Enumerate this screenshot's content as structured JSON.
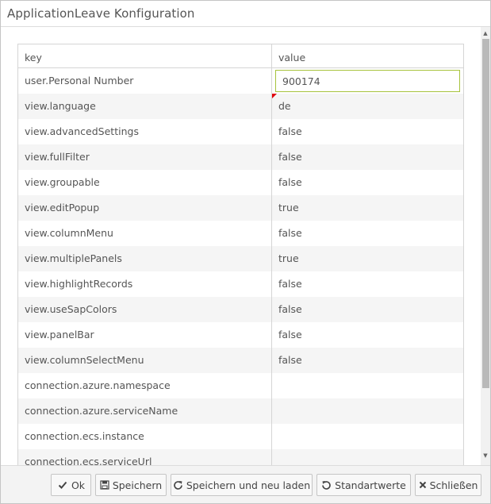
{
  "window": {
    "title": "ApplicationLeave Konfiguration"
  },
  "grid": {
    "columns": {
      "key": "key",
      "value": "value"
    },
    "rows": [
      {
        "key": "user.Personal Number",
        "value": "900174"
      },
      {
        "key": "view.language",
        "value": "de"
      },
      {
        "key": "view.advancedSettings",
        "value": "false"
      },
      {
        "key": "view.fullFilter",
        "value": "false"
      },
      {
        "key": "view.groupable",
        "value": "false"
      },
      {
        "key": "view.editPopup",
        "value": "true"
      },
      {
        "key": "view.columnMenu",
        "value": "false"
      },
      {
        "key": "view.multiplePanels",
        "value": "true"
      },
      {
        "key": "view.highlightRecords",
        "value": "false"
      },
      {
        "key": "view.useSapColors",
        "value": "false"
      },
      {
        "key": "view.panelBar",
        "value": "false"
      },
      {
        "key": "view.columnSelectMenu",
        "value": "false"
      },
      {
        "key": "connection.azure.namespace",
        "value": ""
      },
      {
        "key": "connection.azure.serviceName",
        "value": ""
      },
      {
        "key": "connection.ecs.instance",
        "value": ""
      },
      {
        "key": "connection.ecs.serviceUrl",
        "value": ""
      }
    ]
  },
  "footer": {
    "ok_label": "Ok",
    "save_label": "Speichern",
    "save_reload_label": "Speichern und neu laden",
    "defaults_label": "Standartwerte",
    "close_label": "Schließen"
  },
  "colors": {
    "edit_border": "#a6c33c",
    "dirty_flag": "#e0000b"
  }
}
